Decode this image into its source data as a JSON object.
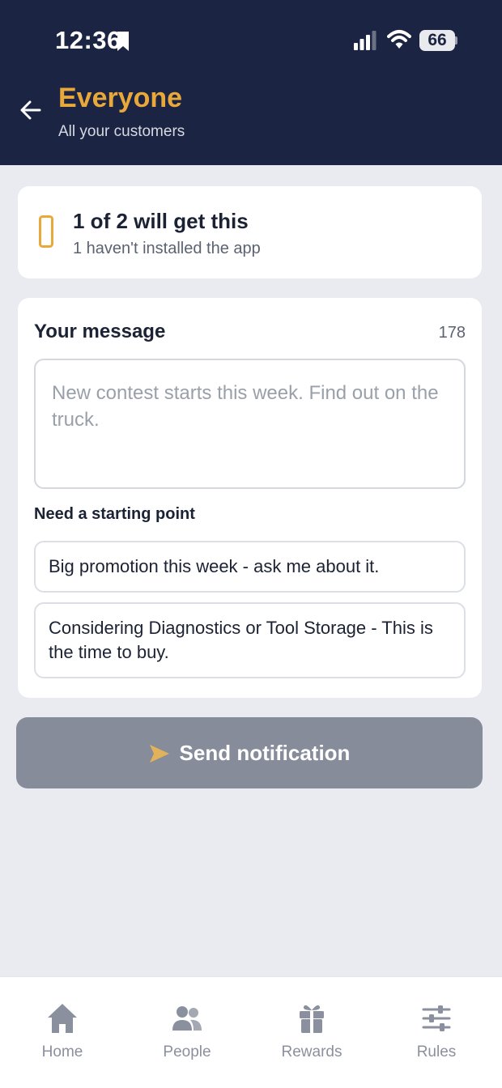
{
  "status_bar": {
    "time": "12:36",
    "battery": "66"
  },
  "header": {
    "title": "Everyone",
    "subtitle": "All your customers"
  },
  "reach": {
    "title": "1 of 2 will get this",
    "subtitle": "1 haven't installed the app"
  },
  "message": {
    "label": "Your message",
    "char_count": "178",
    "placeholder": "New contest starts this week. Find out on the truck.",
    "starting_point_label": "Need a starting point",
    "suggestions": [
      "Big promotion this week - ask me about it.",
      "Considering Diagnostics or Tool Storage - This is the time to buy."
    ]
  },
  "send_button": {
    "label": "Send notification"
  },
  "tabs": [
    {
      "label": "Home",
      "icon": "home-icon"
    },
    {
      "label": "People",
      "icon": "people-icon"
    },
    {
      "label": "Rewards",
      "icon": "gift-icon"
    },
    {
      "label": "Rules",
      "icon": "sliders-icon"
    }
  ],
  "colors": {
    "header_bg": "#1b2442",
    "accent": "#e9a83a",
    "disabled_button": "#868c9a",
    "page_bg": "#e9ebf0"
  }
}
